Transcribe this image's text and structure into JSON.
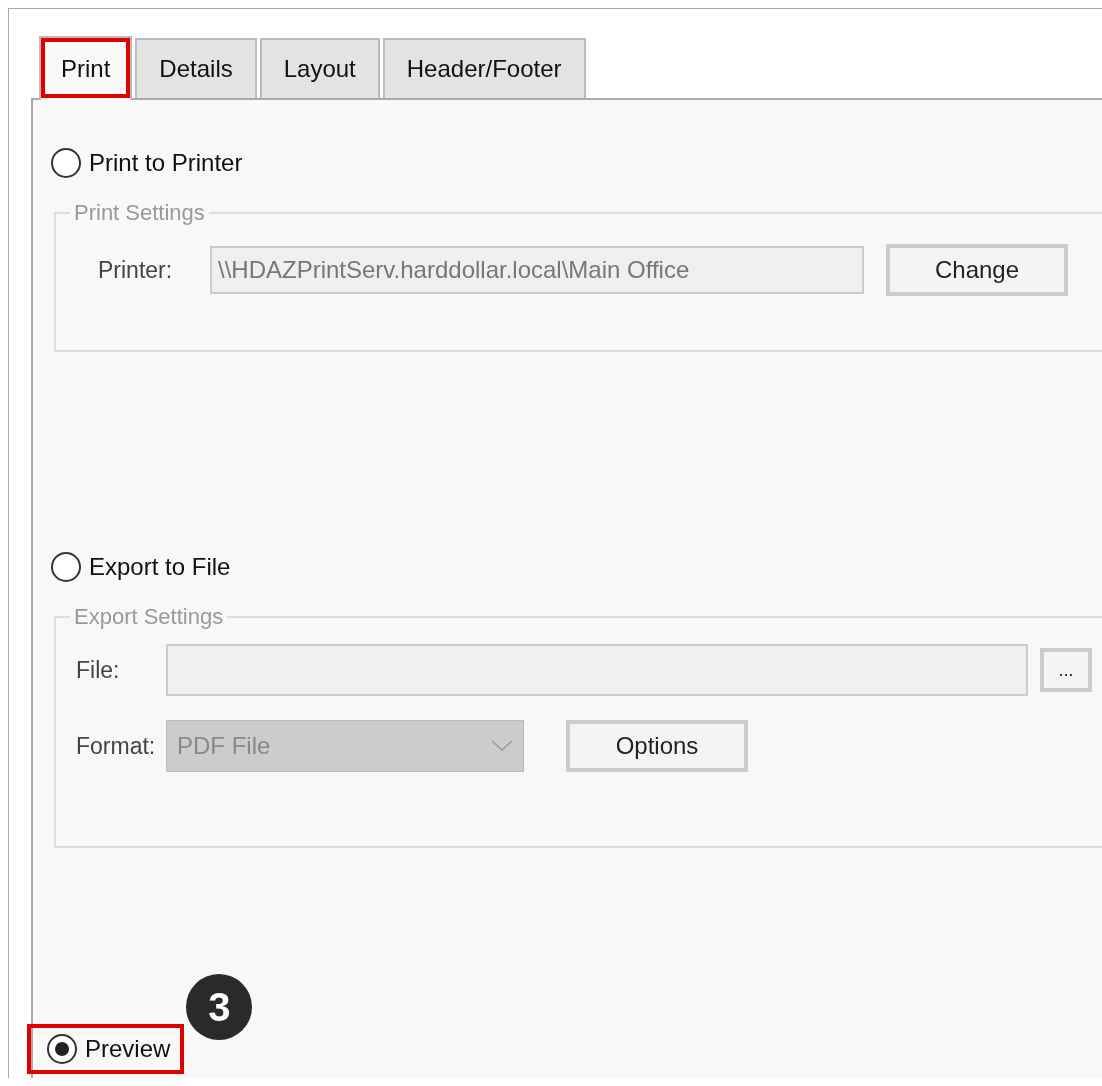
{
  "tabs": [
    {
      "label": "Print",
      "selected": true,
      "highlighted": true
    },
    {
      "label": "Details",
      "selected": false,
      "highlighted": false
    },
    {
      "label": "Layout",
      "selected": false,
      "highlighted": false
    },
    {
      "label": "Header/Footer",
      "selected": false,
      "highlighted": false
    }
  ],
  "print_option": {
    "label": "Print to Printer",
    "selected": false
  },
  "print_settings": {
    "legend": "Print Settings",
    "disabled": true,
    "printer_label": "Printer:",
    "printer_value": "\\\\HDAZPrintServ.harddollar.local\\Main Office",
    "change_button": "Change"
  },
  "export_option": {
    "label": "Export to File",
    "selected": false
  },
  "export_settings": {
    "legend": "Export Settings",
    "disabled": true,
    "file_label": "File:",
    "browse_button": "...",
    "format_label": "Format:",
    "format_value": "PDF File",
    "options_button": "Options"
  },
  "preview_option": {
    "label": "Preview",
    "selected": true,
    "highlighted": true
  },
  "callout": {
    "label": "3"
  }
}
